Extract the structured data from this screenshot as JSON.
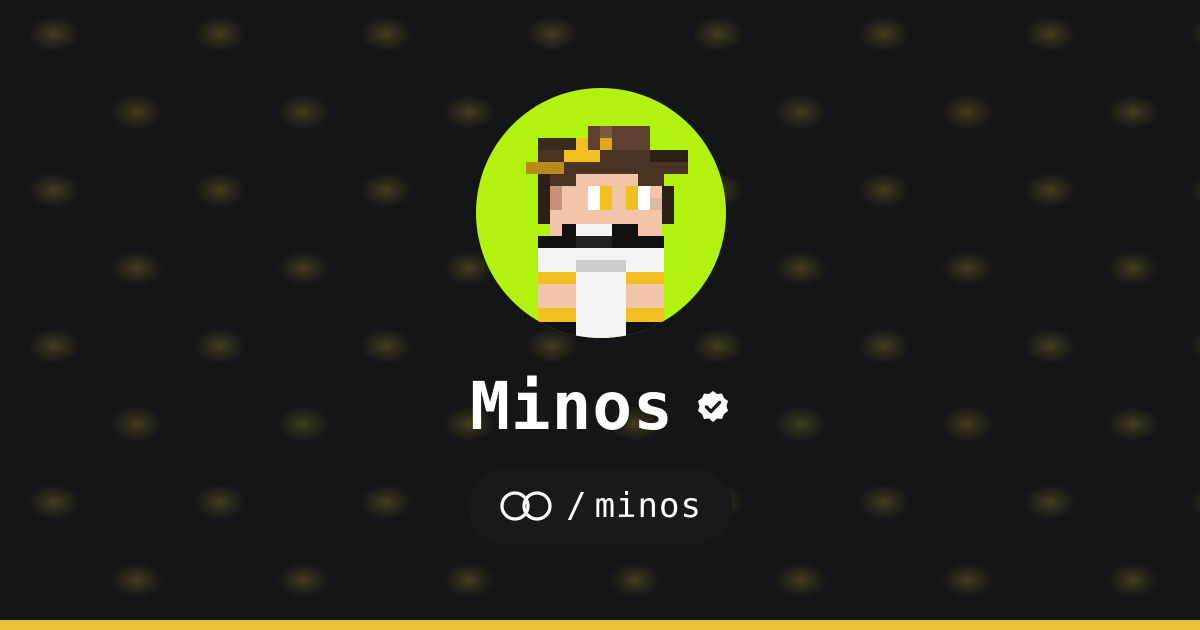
{
  "profile": {
    "display_name": "Minos",
    "handle": "minos",
    "separator": "/",
    "verified": true
  },
  "icons": {
    "verified": "verified-check-icon",
    "logo": "linked-rings-logo-icon"
  },
  "colors": {
    "background": "#141517",
    "pattern_glow": "#706024",
    "avatar_bg": "#b2f20f",
    "accent_bar": "#e9c23a",
    "text": "#ffffff",
    "pill_bg": "#18191b"
  }
}
